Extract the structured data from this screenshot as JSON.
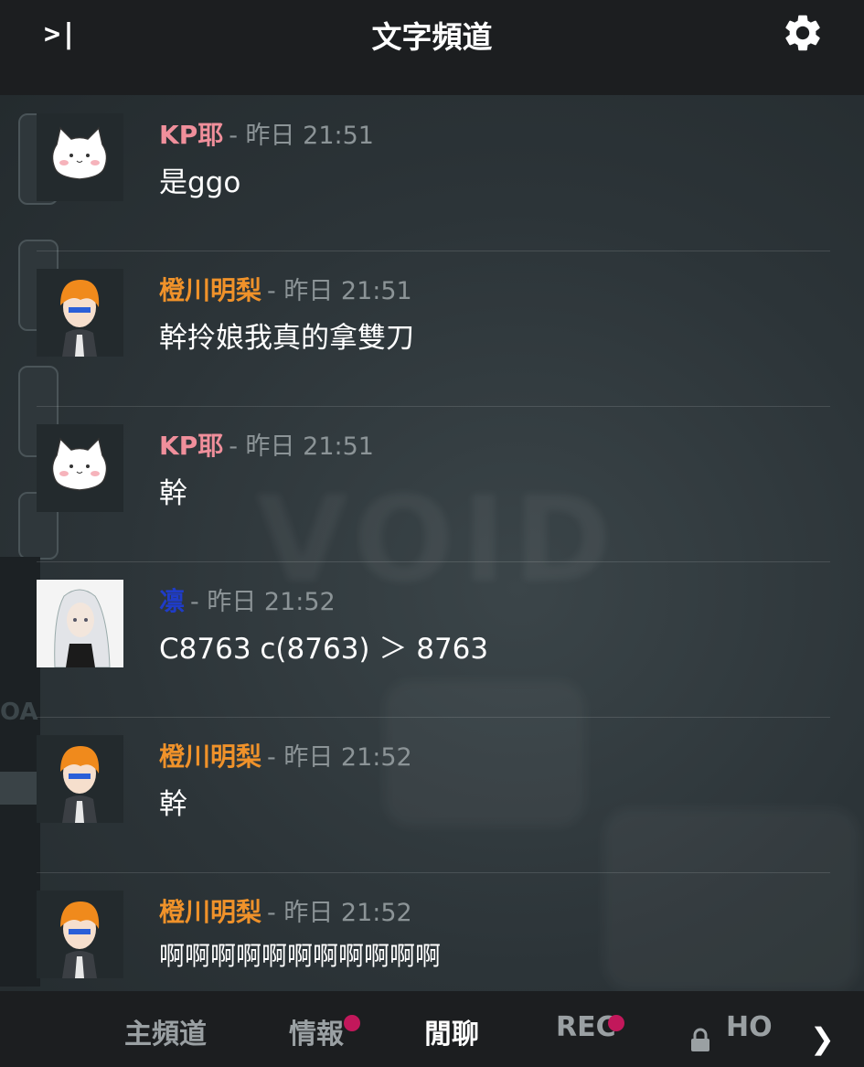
{
  "header": {
    "collapse_icon": "collapse-panel-icon",
    "title": "文字頻道",
    "settings_icon": "gear-icon"
  },
  "messages": [
    {
      "name": "KP耶",
      "name_color": "#f08f9b",
      "time": "- 昨日 21:51",
      "text": "是ggo",
      "avatar": "cat-avatar"
    },
    {
      "name": "橙川明梨",
      "name_color": "#f0922a",
      "time": "- 昨日 21:51",
      "text": "幹拎娘我真的拿雙刀",
      "avatar": "orange-hair-avatar"
    },
    {
      "name": "KP耶",
      "name_color": "#f08f9b",
      "time": "- 昨日 21:51",
      "text": "幹",
      "avatar": "cat-avatar"
    },
    {
      "name": "凛",
      "name_color": "#1f3cc8",
      "time": "- 昨日 21:52",
      "text": "C8763 c(8763) ＞ 8763",
      "avatar": "white-hair-avatar"
    },
    {
      "name": "橙川明梨",
      "name_color": "#f0922a",
      "time": "- 昨日 21:52",
      "text": "幹",
      "avatar": "orange-hair-avatar"
    },
    {
      "name": "橙川明梨",
      "name_color": "#f0922a",
      "time": "- 昨日 21:52",
      "text": "啊啊啊啊啊啊啊啊啊啊啊",
      "avatar": "orange-hair-avatar"
    }
  ],
  "tabs": [
    {
      "label": "主頻道",
      "active": false,
      "notify": false
    },
    {
      "label": "情報",
      "active": false,
      "notify": true
    },
    {
      "label": "閒聊",
      "active": true,
      "notify": false
    },
    {
      "label": "REC",
      "active": false,
      "notify": true
    },
    {
      "label": "HO",
      "active": false,
      "notify": false,
      "locked": true
    }
  ],
  "colors": {
    "notify_dot": "#c2185b",
    "header_bg": "#1c1e20"
  },
  "icons": {
    "lock": "lock-icon",
    "more_tabs": "chevron-right-icon"
  }
}
